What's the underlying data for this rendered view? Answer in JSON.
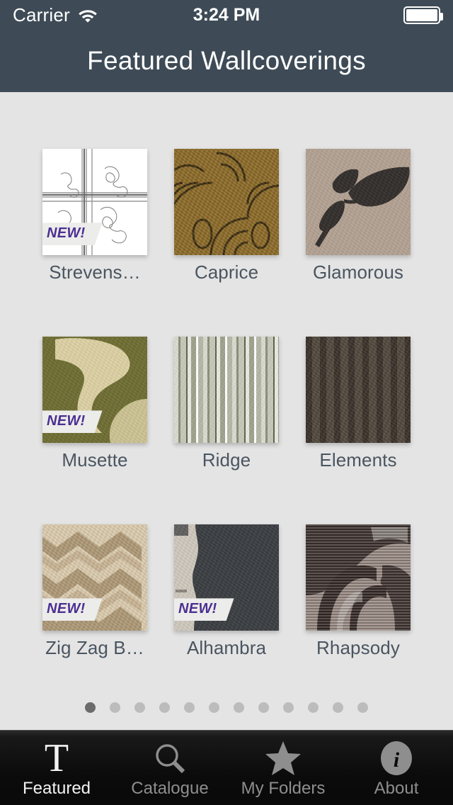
{
  "status_bar": {
    "carrier": "Carrier",
    "wifi_icon": "wifi-icon",
    "time": "3:24 PM",
    "battery_icon": "battery-full-icon"
  },
  "nav": {
    "title": "Featured Wallcoverings"
  },
  "grid": {
    "rows": [
      [
        {
          "name": "Strevens…",
          "badge": "NEW!",
          "art": "art-strevens",
          "icon": "swatch-strevens"
        },
        {
          "name": "Caprice",
          "badge": null,
          "art": "art-caprice",
          "icon": "swatch-caprice"
        },
        {
          "name": "Glamorous",
          "badge": null,
          "art": "art-glamorous",
          "icon": "swatch-glamorous"
        }
      ],
      [
        {
          "name": "Musette",
          "badge": "NEW!",
          "art": "art-musette",
          "icon": "swatch-musette"
        },
        {
          "name": "Ridge",
          "badge": null,
          "art": "art-ridge",
          "icon": "swatch-ridge"
        },
        {
          "name": "Elements",
          "badge": null,
          "art": "art-elements",
          "icon": "swatch-elements"
        }
      ],
      [
        {
          "name": "Zig Zag B…",
          "badge": "NEW!",
          "art": "art-zigzag",
          "icon": "swatch-zigzag"
        },
        {
          "name": "Alhambra",
          "badge": "NEW!",
          "art": "art-alhambra",
          "icon": "swatch-alhambra"
        },
        {
          "name": "Rhapsody",
          "badge": null,
          "art": "art-rhapsody",
          "icon": "swatch-rhapsody"
        }
      ]
    ]
  },
  "pager": {
    "total": 12,
    "active_index": 0
  },
  "tabbar": {
    "tabs": [
      {
        "label": "Featured",
        "icon": "letter-t-icon",
        "active": true
      },
      {
        "label": "Catalogue",
        "icon": "search-icon",
        "active": false
      },
      {
        "label": "My Folders",
        "icon": "star-icon",
        "active": false
      },
      {
        "label": "About",
        "icon": "info-circle-icon",
        "active": false
      }
    ]
  },
  "colors": {
    "nav_background": "#3e4b56",
    "page_background": "#e4e4e4",
    "label_text": "#4a5560",
    "badge_text": "#4b2f92",
    "badge_background": "#ececea",
    "tabbar_background": "#0a0a0a",
    "tab_active": "#f2f2f2",
    "tab_inactive": "#8e8e8e",
    "dot_active": "#6b6b6b",
    "dot_inactive": "#bcbcbc"
  }
}
